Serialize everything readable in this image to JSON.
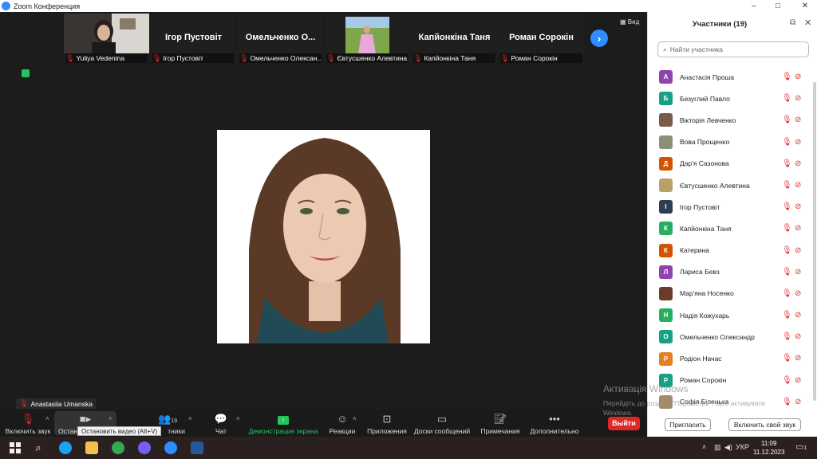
{
  "window": {
    "title": "Zoom Конференция",
    "minimize": "–",
    "maximize": "□",
    "close": "✕"
  },
  "filmstrip": {
    "tiles": [
      {
        "name": "",
        "label": "Yuliya Vedenina"
      },
      {
        "name": "Ігор Пустовіт",
        "label": "Ігор Пустовіт"
      },
      {
        "name": "Омельченко  О...",
        "label": "Омельченко Олексан..."
      },
      {
        "name": "",
        "label": "Євтусшенко Алевтина"
      },
      {
        "name": "Капйонкіна Таня",
        "label": "Капйонкіна Таня"
      },
      {
        "name": "Роман Сорокін",
        "label": "Роман Сорокін"
      }
    ],
    "next": "›",
    "view_label": "Вид"
  },
  "speaker": {
    "label": "Anastasiia Umanska"
  },
  "toolbar": {
    "unmute": "Включить звук",
    "stop_video": "Останс",
    "participants_count": "19",
    "participants": "тники",
    "chat": "Чат",
    "share": "Демонстрация экрана",
    "reactions": "Реакции",
    "apps": "Приложения",
    "whiteboards": "Доски сообщений",
    "notes": "Примечания",
    "more": "Дополнительно",
    "leave": "Выйти",
    "tooltip": "Остановить видео (Alt+V)"
  },
  "panel": {
    "title": "Участники (19)",
    "search_placeholder": "Найти участника",
    "invite": "Пригласить",
    "unmute_me": "Включить свой звук",
    "participants": [
      {
        "name": "Анастасія Проша",
        "initial": "А",
        "color": "#8e44ad",
        "photo": false,
        "video_icon": true
      },
      {
        "name": "Безуглий Павло",
        "initial": "Б",
        "color": "#16a085",
        "photo": false,
        "video_icon": true
      },
      {
        "name": "Вікторія Левченко",
        "initial": "",
        "color": "#7a5a4a",
        "photo": true,
        "video_icon": true
      },
      {
        "name": "Вова Прощенко",
        "initial": "",
        "color": "#8a8f7a",
        "photo": true,
        "video_icon": true
      },
      {
        "name": "Дар'я Сазонова",
        "initial": "Д",
        "color": "#d35400",
        "photo": false,
        "video_icon": true
      },
      {
        "name": "Євтусшенко Алевтина",
        "initial": "",
        "color": "#b8a16a",
        "photo": true,
        "video_icon": true
      },
      {
        "name": "Ігор Пустовіт",
        "initial": "І",
        "color": "#2c3e50",
        "photo": false,
        "video_icon": true
      },
      {
        "name": "Капйонкіна Таня",
        "initial": "К",
        "color": "#27ae60",
        "photo": false,
        "video_icon": true
      },
      {
        "name": "Катерина",
        "initial": "К",
        "color": "#d35400",
        "photo": false,
        "video_icon": true
      },
      {
        "name": "Лариса Бевз",
        "initial": "Л",
        "color": "#8e44ad",
        "photo": false,
        "video_icon": false
      },
      {
        "name": "Мар'яна Носенко",
        "initial": "",
        "color": "#6b3a2a",
        "photo": true,
        "video_icon": true
      },
      {
        "name": "Надія Кожухарь",
        "initial": "Н",
        "color": "#27ae60",
        "photo": false,
        "video_icon": true
      },
      {
        "name": "Омельченко Олександр",
        "initial": "О",
        "color": "#16a085",
        "photo": false,
        "video_icon": true
      },
      {
        "name": "Родіон Начас",
        "initial": "Р",
        "color": "#e67e22",
        "photo": false,
        "video_icon": true
      },
      {
        "name": "Роман Сорокін",
        "initial": "Р",
        "color": "#16a085",
        "photo": false,
        "video_icon": true
      },
      {
        "name": "Софія Біленька",
        "initial": "",
        "color": "#a48a6a",
        "photo": true,
        "video_icon": true
      }
    ]
  },
  "watermark": {
    "title": "Активація Windows",
    "line1": "Перейдіть до розділу \"Параметри\", щоб активувати",
    "line2": "Windows."
  },
  "taskbar": {
    "lang": "УКР",
    "time": "11:09",
    "date": "11.12.2023",
    "notif_count": "1",
    "tray_chevron": "˄"
  }
}
